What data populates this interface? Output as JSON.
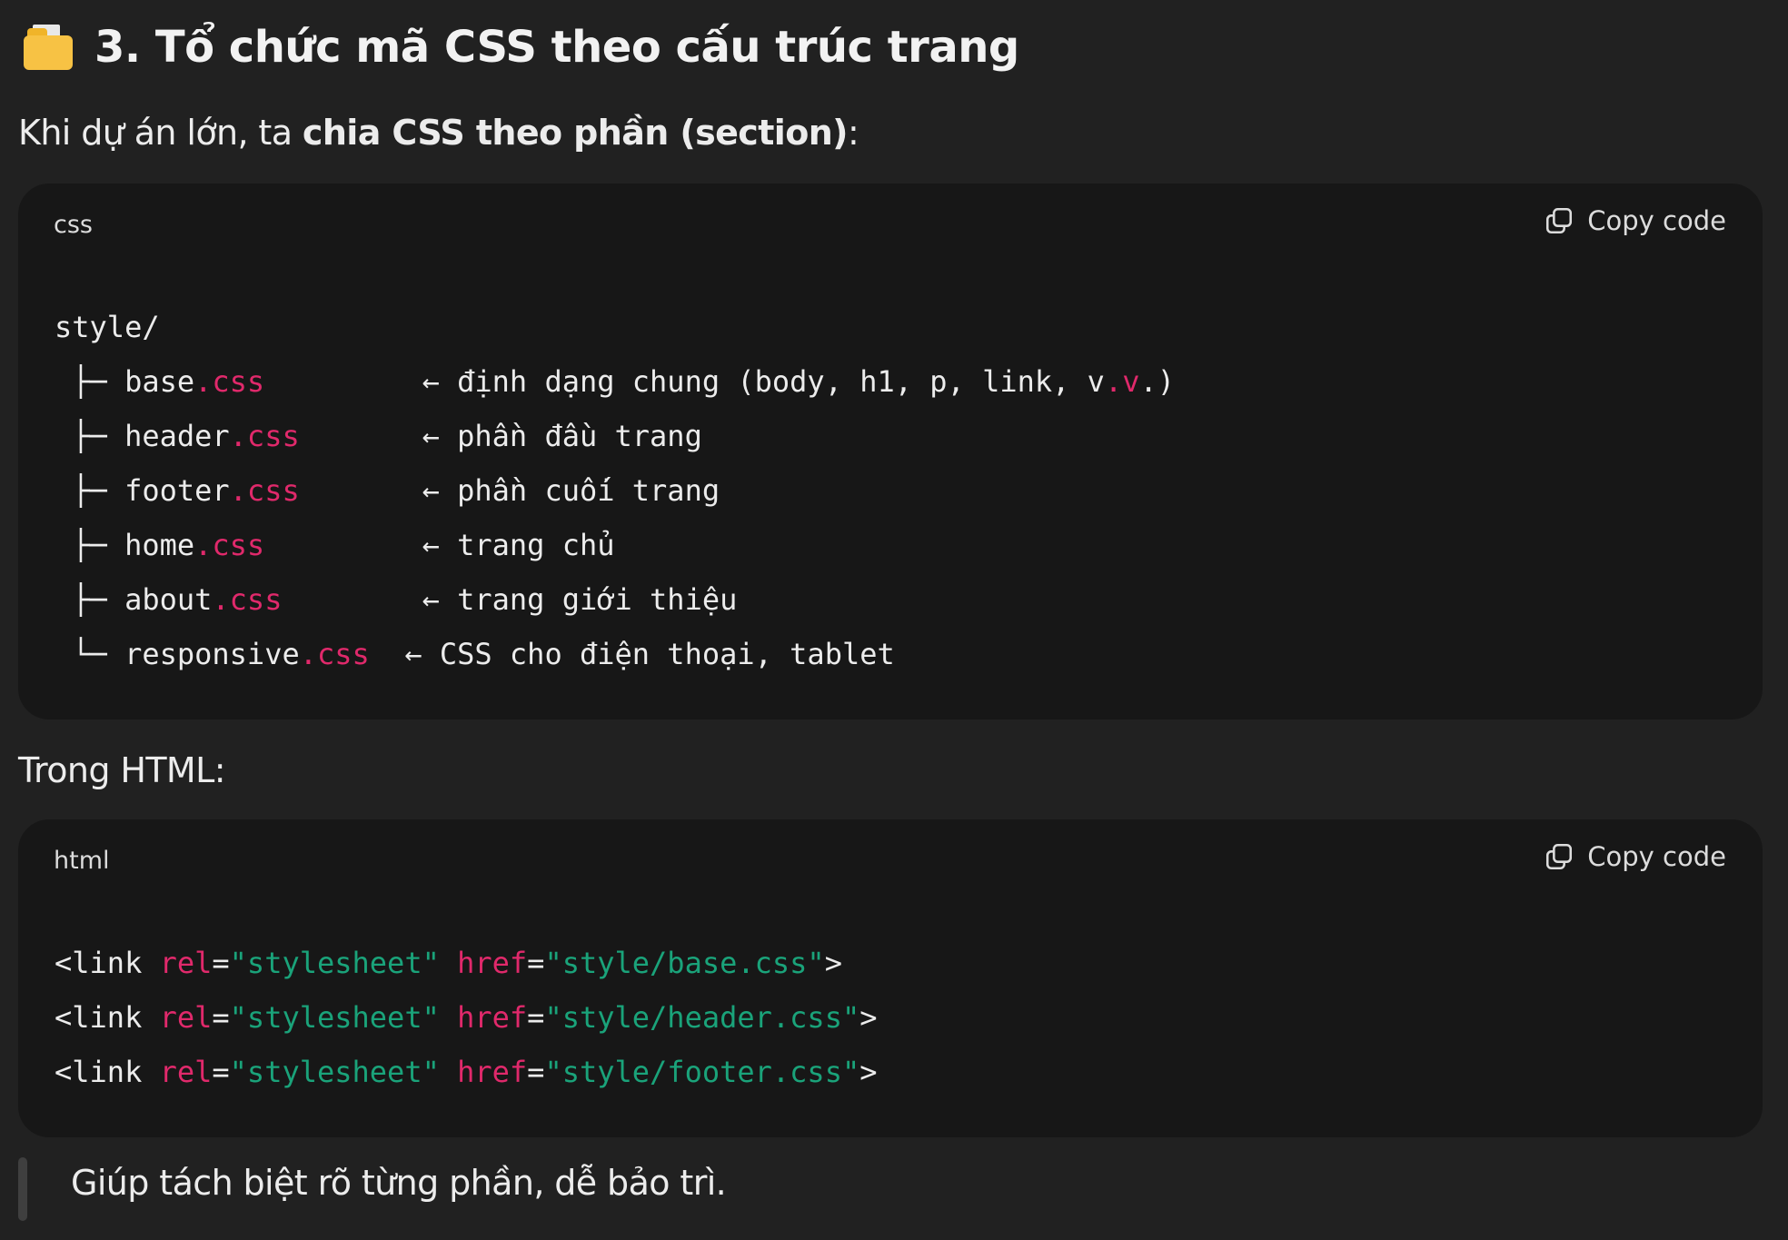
{
  "heading": {
    "icon": "card-index-dividers-icon",
    "text": "3. Tổ chức mã CSS theo cấu trúc trang"
  },
  "intro": {
    "prefix": "Khi dự án lớn, ta ",
    "bold": "chia CSS theo phần (section)",
    "suffix": ":"
  },
  "code_block_1": {
    "language": "css",
    "copy_label": "Copy code",
    "lines": [
      {
        "prefix": "style/",
        "name": "",
        "ext": "",
        "pad": "",
        "comment": ""
      },
      {
        "prefix": " ├─ ",
        "name": "base",
        "ext": ".css",
        "pad": "         ",
        "comment": "← định dạng chung (body, h1, p, link, v",
        "comment_ext": ".v",
        "comment_end": ".)"
      },
      {
        "prefix": " ├─ ",
        "name": "header",
        "ext": ".css",
        "pad": "       ",
        "comment": "← phần đầu trang"
      },
      {
        "prefix": " ├─ ",
        "name": "footer",
        "ext": ".css",
        "pad": "       ",
        "comment": "← phần cuối trang"
      },
      {
        "prefix": " ├─ ",
        "name": "home",
        "ext": ".css",
        "pad": "         ",
        "comment": "← trang chủ"
      },
      {
        "prefix": " ├─ ",
        "name": "about",
        "ext": ".css",
        "pad": "        ",
        "comment": "← trang giới thiệu"
      },
      {
        "prefix": " └─ ",
        "name": "responsive",
        "ext": ".css",
        "pad": "  ",
        "comment": "← CSS cho điện thoại, tablet"
      }
    ]
  },
  "trong_html": "Trong HTML:",
  "code_block_2": {
    "language": "html",
    "copy_label": "Copy code",
    "lines": [
      {
        "tag": "<link",
        "rel": "rel",
        "rel_val": "\"stylesheet\"",
        "href": "href",
        "href_val": "\"style/base.css\"",
        "close": ">"
      },
      {
        "tag": "<link",
        "rel": "rel",
        "rel_val": "\"stylesheet\"",
        "href": "href",
        "href_val": "\"style/header.css\"",
        "close": ">"
      },
      {
        "tag": "<link",
        "rel": "rel",
        "rel_val": "\"stylesheet\"",
        "href": "href",
        "href_val": "\"style/footer.css\"",
        "close": ">"
      }
    ]
  },
  "quote": "Giúp tách biệt rõ từng phần, dễ bảo trì."
}
